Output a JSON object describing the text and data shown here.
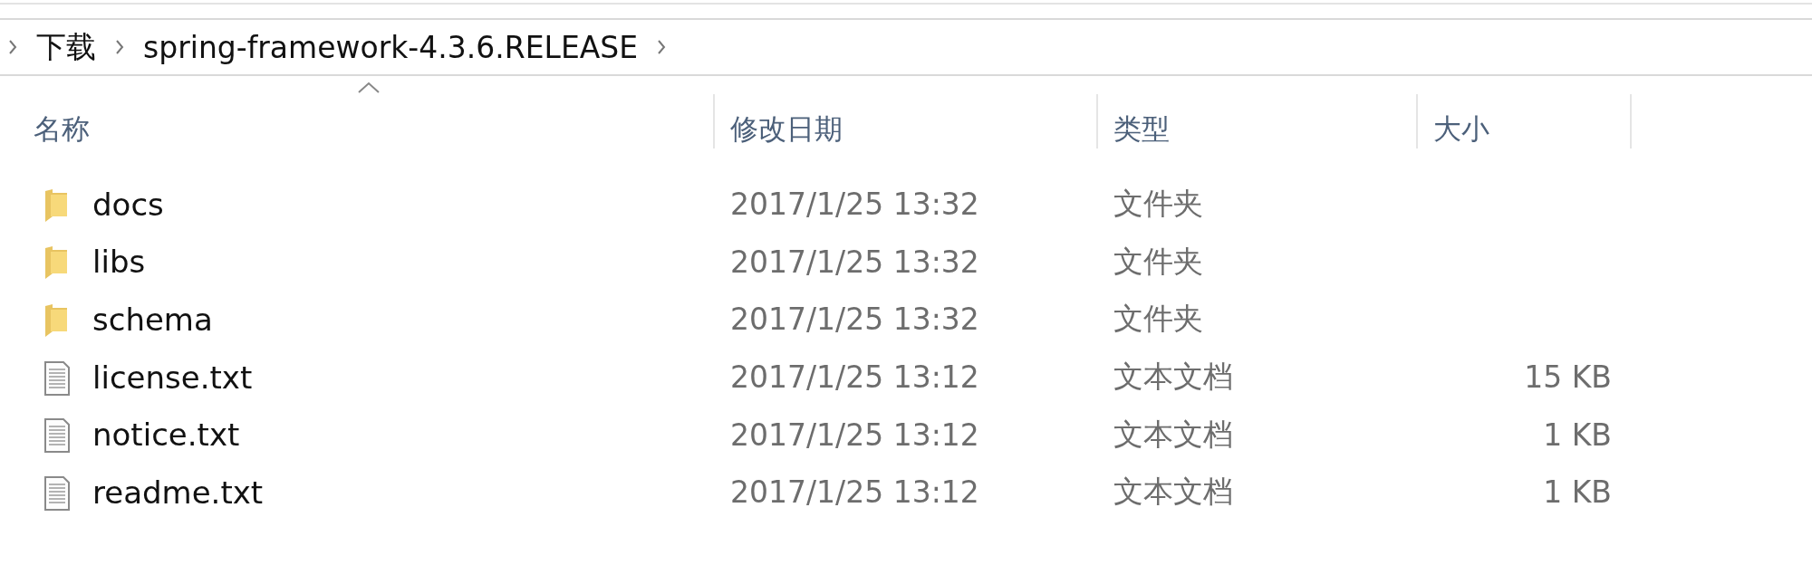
{
  "breadcrumb": {
    "items": [
      "下载",
      "spring-framework-4.3.6.RELEASE"
    ]
  },
  "columns": [
    {
      "label": "名称",
      "sorted": true
    },
    {
      "label": "修改日期",
      "sorted": false
    },
    {
      "label": "类型",
      "sorted": false
    },
    {
      "label": "大小",
      "sorted": false
    }
  ],
  "files": [
    {
      "kind": "folder",
      "name": "docs",
      "modified": "2017/1/25 13:32",
      "type": "文件夹"
    },
    {
      "kind": "folder",
      "name": "libs",
      "modified": "2017/1/25 13:32",
      "type": "文件夹"
    },
    {
      "kind": "folder",
      "name": "schema",
      "modified": "2017/1/25 13:32",
      "type": "文件夹"
    },
    {
      "kind": "text",
      "name": "license.txt",
      "modified": "2017/1/25 13:12",
      "type": "文本文档",
      "size": "15 KB"
    },
    {
      "kind": "text",
      "name": "notice.txt",
      "modified": "2017/1/25 13:12",
      "type": "文本文档",
      "size": "1 KB"
    },
    {
      "kind": "text",
      "name": "readme.txt",
      "modified": "2017/1/25 13:12",
      "type": "文本文档",
      "size": "1 KB"
    }
  ]
}
